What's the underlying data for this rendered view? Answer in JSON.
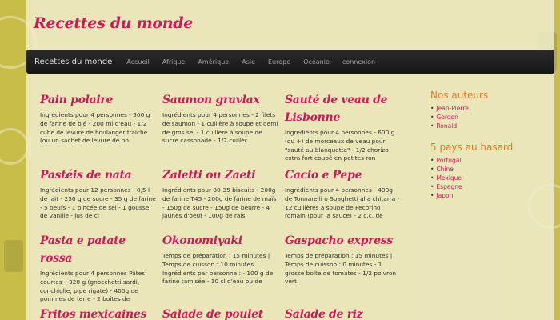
{
  "site": {
    "title": "Recettes du monde"
  },
  "nav": {
    "brand": "Recettes du monde",
    "items": [
      "Accueil",
      "Afrique",
      "Amérique",
      "Asie",
      "Europe",
      "Océanie",
      "connexion"
    ]
  },
  "recipes": [
    {
      "title": "Pain polaire",
      "text": "Ingrédients pour 4 personnes - 500 g de farine de blé - 200 ml d'eau - 1/2 cube de levure de boulanger fraîche (ou un sachet de levure de bo"
    },
    {
      "title": "Saumon gravlax",
      "text": "Ingrédients pour 4 personnes - 2 filets de saumon - 1 cuillère à soupe et demi de gros sel - 1 cuillère à soupe de sucre cassonade - 1/2 cuillèr"
    },
    {
      "title": "Sauté de veau de Lisbonne",
      "text": "Ingrédients pour 4 personnes - 600 g (ou +) de morceaux de veau pour \"sauté ou blanquette\" - 1/2 chorizo extra fort coupé en petites ron"
    },
    {
      "title": "Pastéis de nata",
      "text": "Ingrédients pour 12 personnes - 0,5 l de lait - 250 g de sucre - 35 g de farine - 5 oeufs - 1 pincée de sel - 1 gousse de vanille - jus de ci"
    },
    {
      "title": "Zaletti ou Zaeti",
      "text": "Ingrédients pour 30-35 biscuits - 200g de farine T45 - 200g de farine de maïs - 150g de sucre - 150g de beurre - 4 jaunes d'oeuf - 100g de rais"
    },
    {
      "title": "Cacio e Pepe",
      "text": "Ingrédients pour 4 personnes - 400g de Tonnarelli o Spaghetti alla chitarra - 12 cuillères à soupe de Pecorino romain (pour la sauce) - 2 c.c. de"
    },
    {
      "title": "Pasta e patate rossa",
      "text": "Ingrédients pour 4 personnes Pâtes courtes – 320 g (gnocchetti sardi, conchiglie, pipe rigate) - 400g de pommes de terre - 2 boîtes de"
    },
    {
      "title": "Okonomiyaki",
      "text": "Temps de préparation : 15 minutes | Temps de cuisson : 10 minutes Ingrédients par personne : - 100 g de farine tamisée - 10 cl d'eau ou de"
    },
    {
      "title": "Gaspacho express",
      "text": "Temps de préparation : 15 minutes | Temps de cuisson : 0 minutes - 1 grosse boîte de tomates - 1/2 poivron vert"
    },
    {
      "title": "Fritos mexicaines",
      "text": ""
    },
    {
      "title": "Salade de poulet",
      "text": ""
    },
    {
      "title": "Salade de riz",
      "text": ""
    }
  ],
  "sidebar": {
    "authors_title": "Nos auteurs",
    "authors": [
      "Jean-Pierre",
      "Gordon",
      "Ronald"
    ],
    "countries_title": "5 pays au hasard",
    "countries": [
      "Portugal",
      "Chine",
      "Mexique",
      "Espagne",
      "Japon"
    ]
  }
}
